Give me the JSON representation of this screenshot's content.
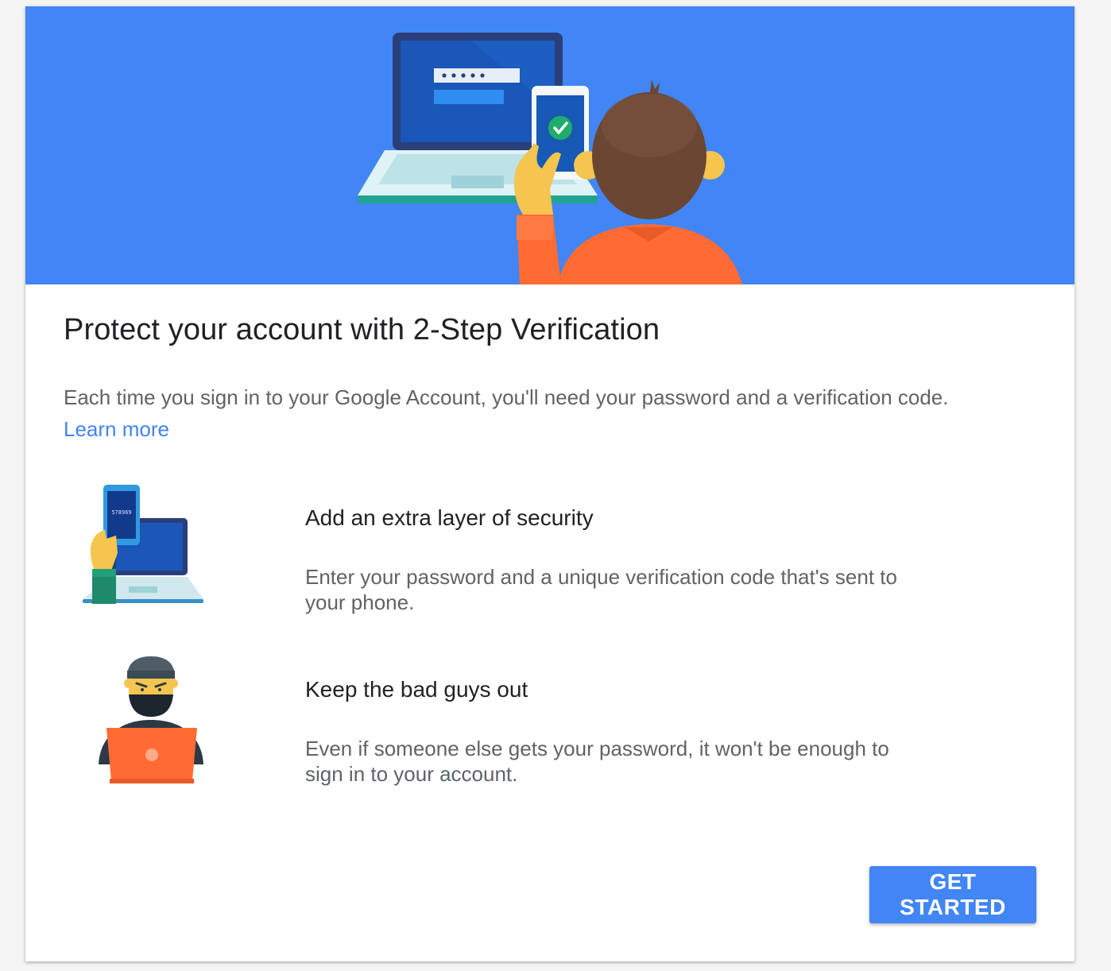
{
  "hero": {
    "illustration": "laptop-and-phone-verification",
    "background_color": "#4285f4"
  },
  "main": {
    "title": "Protect your account with 2-Step Verification",
    "description": "Each time you sign in to your Google Account, you'll need your password and a verification code.",
    "learn_more": "Learn more"
  },
  "features": [
    {
      "icon": "phone-code-laptop-icon",
      "code": "578969",
      "title": "Add an extra layer of security",
      "description": "Enter your password and a unique verification code that's sent to your phone."
    },
    {
      "icon": "hacker-icon",
      "title": "Keep the bad guys out",
      "description": "Even if someone else gets your password, it won't be enough to sign in to your account."
    }
  ],
  "actions": {
    "get_started": "GET STARTED"
  },
  "colors": {
    "accent": "#4285f4",
    "title_text": "#202124",
    "body_text": "#5f6368"
  }
}
